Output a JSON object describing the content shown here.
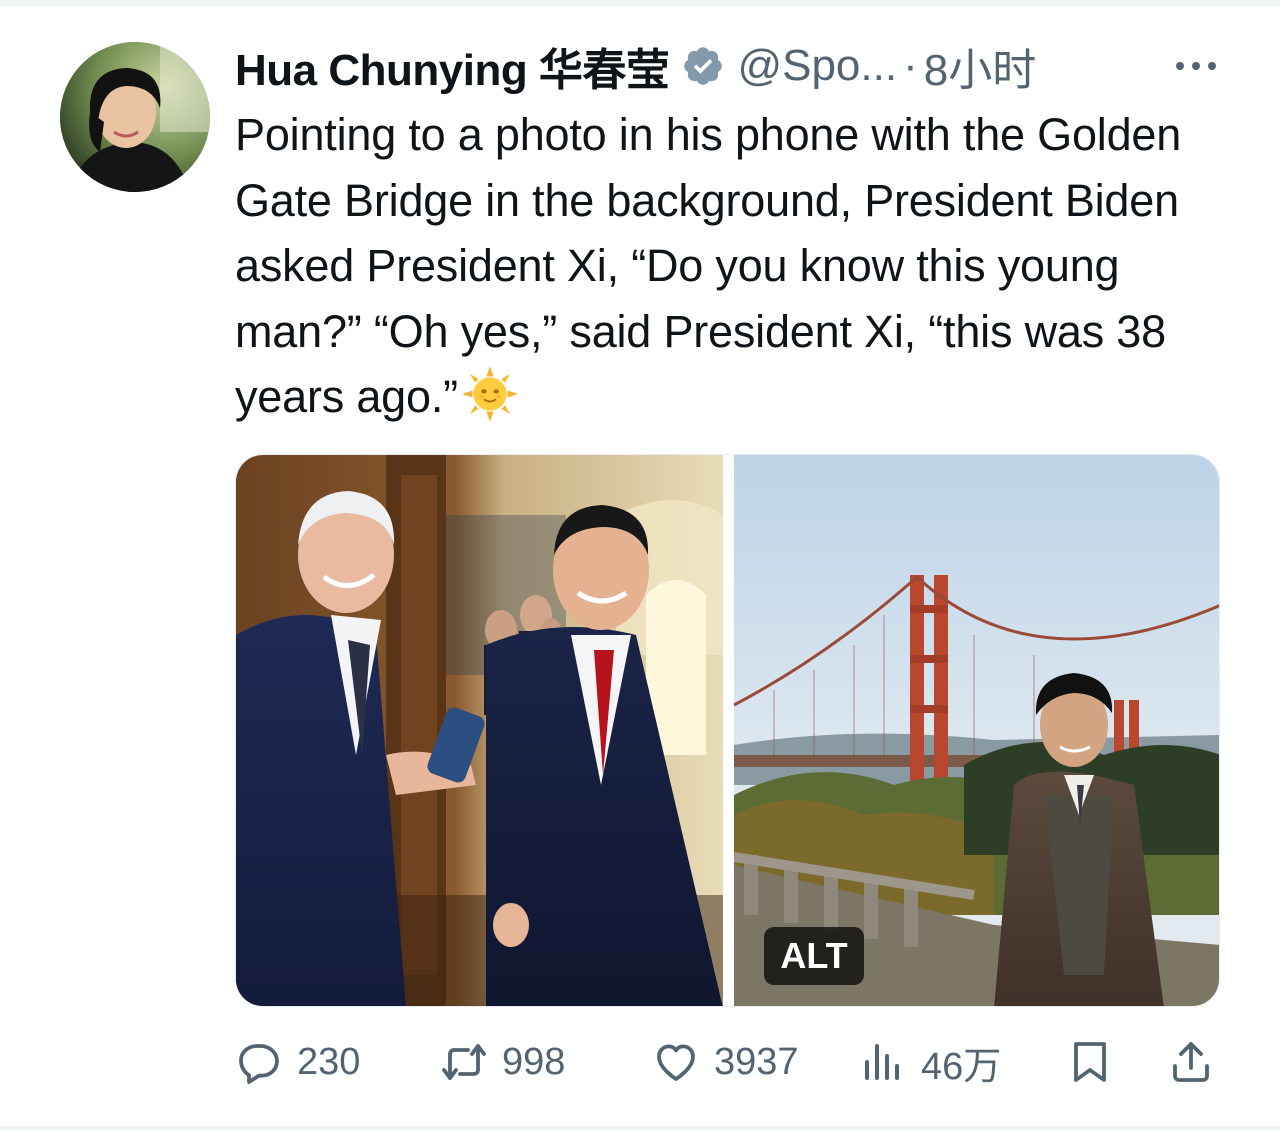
{
  "author": {
    "display_name": "Hua Chunying 华春莹",
    "handle": "@Spo...",
    "separator": "·",
    "timestamp": "8小时"
  },
  "tweet": {
    "text": "Pointing to a photo in his phone with the Golden Gate Bridge in the background, President Biden asked President Xi, “Do you know this young man?” “Oh yes,” said President Xi, “this was 38 years ago.”",
    "emoji": "sun-with-face"
  },
  "media": {
    "alt_badge": "ALT"
  },
  "actions": {
    "replies": "230",
    "reposts": "998",
    "likes": "3937",
    "views": "46万"
  },
  "colors": {
    "text": "#0f1419",
    "secondary": "#536471",
    "verified": "#829aab"
  },
  "icons": [
    "verified-badge-icon",
    "more-icon",
    "reply-icon",
    "repost-icon",
    "like-icon",
    "views-icon",
    "bookmark-icon",
    "share-icon"
  ]
}
